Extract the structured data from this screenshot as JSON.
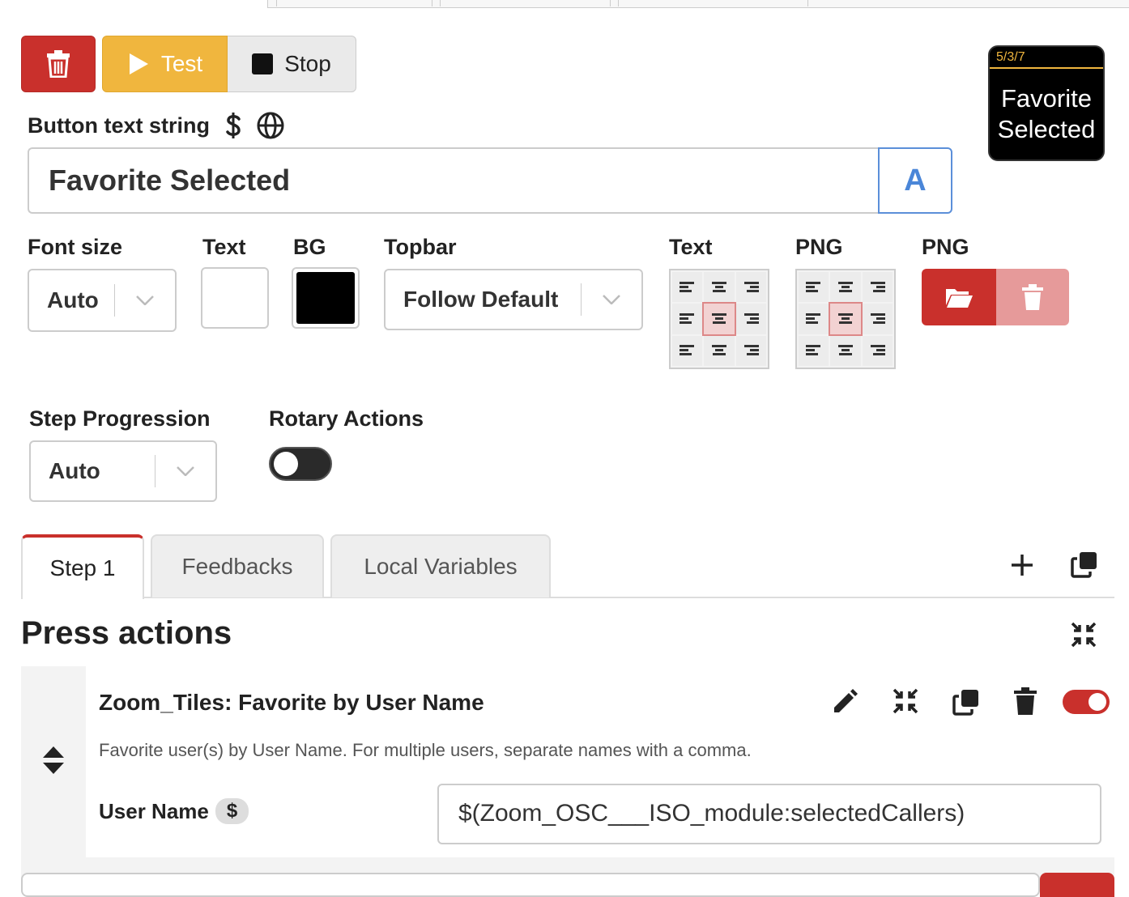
{
  "toolbar": {
    "delete_icon": "trash-icon",
    "test_label": "Test",
    "stop_label": "Stop"
  },
  "preview": {
    "page_ref": "5/3/7",
    "text": "Favorite Selected"
  },
  "button_text": {
    "label": "Button text string",
    "value": "Favorite Selected",
    "format_button": "A"
  },
  "style": {
    "font_size_label": "Font size",
    "font_size_value": "Auto",
    "text_color_label": "Text",
    "text_color": "#ffffff",
    "bg_label": "BG",
    "bg_color": "#000000",
    "topbar_label": "Topbar",
    "topbar_value": "Follow Default",
    "text_align_label": "Text",
    "png_align_label": "PNG",
    "png_label": "PNG"
  },
  "options": {
    "step_progression_label": "Step Progression",
    "step_progression_value": "Auto",
    "rotary_label": "Rotary Actions",
    "rotary_enabled": false
  },
  "tabs": [
    {
      "label": "Step 1",
      "active": true
    },
    {
      "label": "Feedbacks",
      "active": false
    },
    {
      "label": "Local Variables",
      "active": false
    }
  ],
  "press_actions": {
    "title": "Press actions",
    "action": {
      "title": "Zoom_Tiles: Favorite by User Name",
      "description": "Favorite user(s) by User Name. For multiple users, separate names with a comma.",
      "field_label": "User Name",
      "field_badge": "$",
      "field_value": "$(Zoom_OSC___ISO_module:selectedCallers)",
      "enabled": true
    }
  },
  "colors": {
    "danger": "#c9302c",
    "warning": "#f0b63e",
    "accent": "#4a86d8"
  }
}
